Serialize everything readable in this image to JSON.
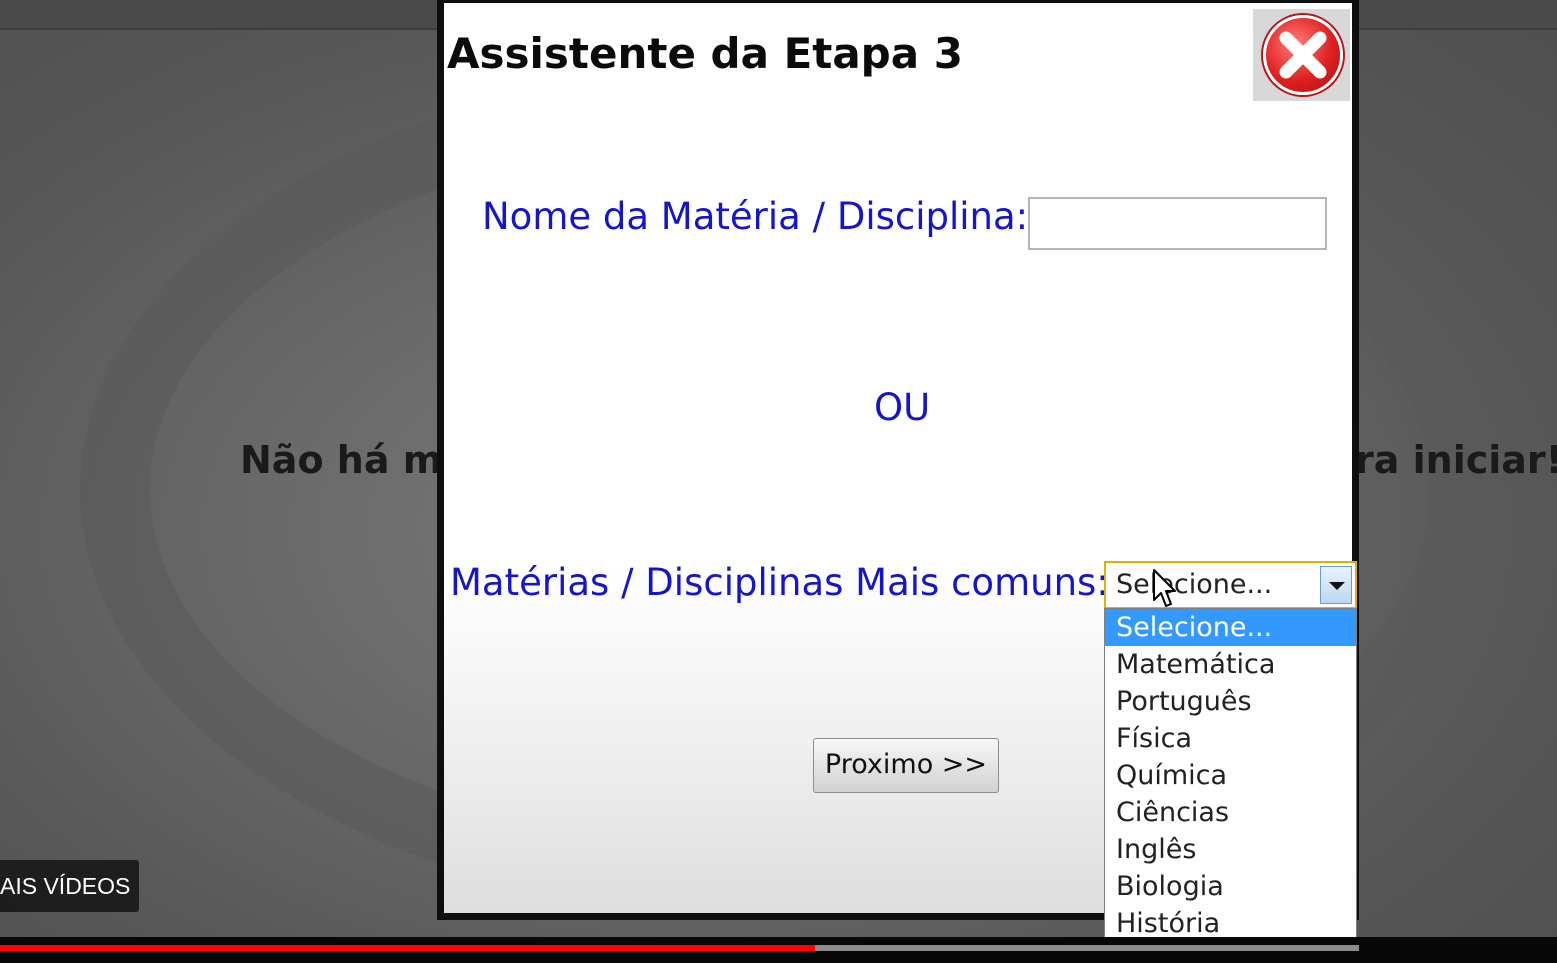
{
  "background": {
    "text_left": "Não há m",
    "text_right": "ra iniciar!"
  },
  "dialog": {
    "title": "Assistente da Etapa 3",
    "close_icon": "close-circle-red-x",
    "name_label": "Nome da Matéria / Disciplina:",
    "name_input_value": "",
    "or_label": "OU",
    "common_label": "Matérias / Disciplinas Mais comuns:",
    "select": {
      "selected": "Selecione...",
      "options": [
        "Selecione...",
        "Matemática",
        "Português",
        "Física",
        "Química",
        "Ciências",
        "Inglês",
        "Biologia",
        "História"
      ]
    },
    "next_button": "Proximo >>"
  },
  "player": {
    "more_videos": "AIS VÍDEOS",
    "progress_fraction": 0.6,
    "colors": {
      "progress_played": "#ff0000",
      "progress_track": "#8b8b8b"
    }
  },
  "colors": {
    "label_blue": "#1515cc",
    "selected_option": "#3399ff",
    "select_border": "#e0b000"
  }
}
